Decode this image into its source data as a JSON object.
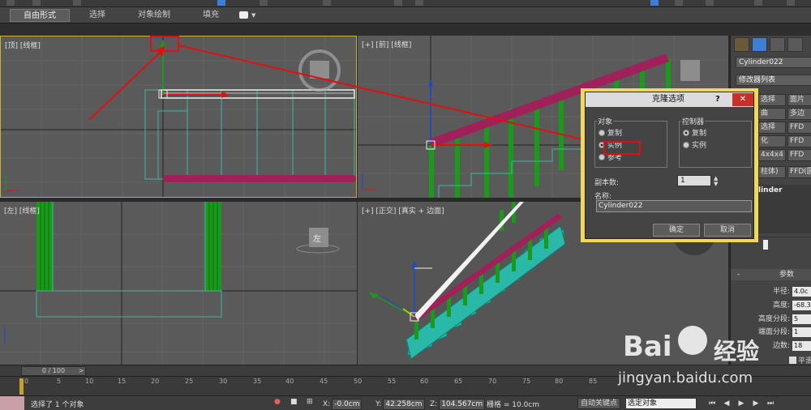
{
  "ribbon": {
    "tabs": [
      "自由形式",
      "选择",
      "对象绘制",
      "填充"
    ],
    "active_tab": "自由形式"
  },
  "viewports": {
    "top": {
      "label": "[顶] [线框]"
    },
    "front": {
      "label": "[+] [前] [线框]"
    },
    "left": {
      "label": "[左] [线框]",
      "cube_label": "左"
    },
    "perspective": {
      "label": "[+] [正交] [真实 + 边面]"
    }
  },
  "command_panel": {
    "object_name": "Cylinder022",
    "modifier_list": "修改器列表",
    "modifier_buttons": [
      "选择",
      "面片",
      "曲",
      "多边",
      "选择",
      "FFD",
      "化",
      "FFD",
      "4x4x4",
      "FFD",
      "柱体)",
      "FFD(圆"
    ],
    "stack_item": "linder",
    "rollout_title": "参数",
    "params": [
      {
        "label": "半径:",
        "value": "4.0c"
      },
      {
        "label": "高度:",
        "value": "-68.3"
      },
      {
        "label": "高度分段:",
        "value": "5"
      },
      {
        "label": "端面分段:",
        "value": "1"
      },
      {
        "label": "边数:",
        "value": "18"
      }
    ],
    "checks": [
      "平滑",
      "启用"
    ]
  },
  "dialog": {
    "title": "克隆选项",
    "help": "?",
    "close": "✕",
    "object_group": "对象",
    "object_options": [
      "复制",
      "实例",
      "参考"
    ],
    "object_selected": "实例",
    "controller_group": "控制器",
    "controller_options": [
      "复制",
      "实例"
    ],
    "controller_selected": "复制",
    "copies_label": "副本数:",
    "copies_value": "1",
    "name_label": "名称:",
    "name_value": "Cylinder022",
    "ok": "确定",
    "cancel": "取消"
  },
  "timeline": {
    "position": "0 / 100",
    "next": ">",
    "ticks": [
      "0",
      "5",
      "10",
      "15",
      "20",
      "25",
      "30",
      "35",
      "40",
      "45",
      "50",
      "55",
      "60",
      "65",
      "70",
      "75",
      "80",
      "85"
    ]
  },
  "status": {
    "message": "选择了 1 个对象",
    "x_label": "X:",
    "x_value": "-0.0cm",
    "y_label": "Y:",
    "y_value": "42.258cm",
    "z_label": "Z:",
    "z_value": "104.567cm",
    "grid": "栅格 = 10.0cm",
    "autokey": "自动关键点",
    "selection_set": "选定对象"
  },
  "watermark": {
    "brand": "Bai",
    "brand2": "经验",
    "url": "jingyan.baidu.com"
  },
  "colors": {
    "dialog_frame": "#f1d75b",
    "annotation": "#e01010",
    "rail": "#a0205a",
    "post": "#1a9a1a",
    "stair": "#2ab8a8"
  }
}
